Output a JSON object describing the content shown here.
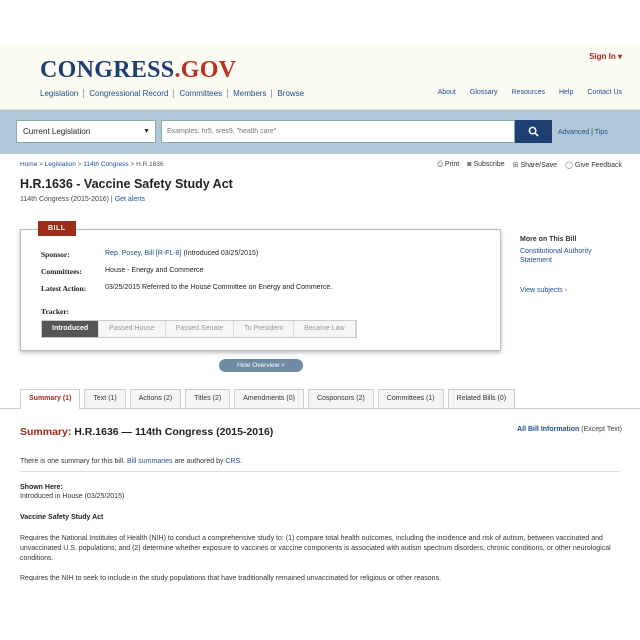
{
  "header": {
    "logo_main": "CONGRESS",
    "logo_dot": ".",
    "logo_gov": "GOV",
    "signin": "Sign In ▾",
    "nav_left": [
      "Legislation",
      "Congressional Record",
      "Committees",
      "Members",
      "Browse"
    ],
    "nav_right": [
      "About",
      "Glossary",
      "Resources",
      "Help",
      "Contact Us"
    ]
  },
  "search": {
    "collection": "Current Legislation",
    "placeholder": "Examples: hr5, sres9, \"health care\"",
    "button_icon": "search-icon",
    "advanced": "Advanced",
    "separator": " | ",
    "tips": "Tips"
  },
  "breadcrumb": {
    "home": "Home",
    "legislation": "Legislation",
    "congress": "114th Congress",
    "sep": " > ",
    "current": "H.R.1636"
  },
  "tools": {
    "print": "Print",
    "subscribe": "Subscribe",
    "share": "Share/Save",
    "feedback": "Give Feedback"
  },
  "bill": {
    "title": "H.R.1636 - Vaccine Safety Study Act",
    "congress": "114th Congress (2015-2016)",
    "divider": " | ",
    "get_alerts": "Get alerts"
  },
  "overview": {
    "tag": "BILL",
    "sponsor_label": "Sponsor:",
    "sponsor_link": "Rep. Posey, Bill [R-FL-8]",
    "sponsor_suffix": " (Introduced 03/25/2015)",
    "committees_label": "Committees:",
    "committees_value": "House - Energy and Commerce",
    "latest_label": "Latest Action:",
    "latest_value": "03/25/2015 Referred to the House Committee on Energy and Commerce.",
    "tracker_label": "Tracker:",
    "tracker_steps": [
      "Introduced",
      "Passed House",
      "Passed Senate",
      "To President",
      "Became Law"
    ],
    "tracker_current": "Introduced"
  },
  "more_on": {
    "heading": "More on This Bill",
    "link1": "Constitutional Authority",
    "link2": "Statement",
    "view_subjects": "View subjects",
    "arrow": " ›"
  },
  "hide_overview": "Hide Overview ×",
  "tabs": [
    "Summary (1)",
    "Text (1)",
    "Actions (2)",
    "Titles (2)",
    "Amendments (0)",
    "Cosponsors (2)",
    "Committees (1)",
    "Related Bills (0)"
  ],
  "summary": {
    "heading_red": "Summary:",
    "heading_rest": " H.R.1636 — 114th Congress (2015-2016)",
    "all_info_link": "All Bill Information",
    "all_info_suffix": " (Except Text)",
    "count_prefix": "There is one summary for this bill. ",
    "summaries_link": "Bill summaries",
    "authored": " are authored by ",
    "crs_link": "CRS",
    "period": ".",
    "shown_here": "Shown Here:",
    "shown_value": "Introduced in House (03/25/2015)",
    "act_name": "Vaccine Safety Study Act",
    "para1": "Requires the National Institutes of Health (NIH) to conduct a comprehensive study to: (1) compare total health outcomes, including the incidence and risk of autism, between vaccinated and unvaccinated U.S. populations; and (2) determine whether exposure to vaccines or vaccine components is associated with autism spectrum disorders, chronic conditions, or other neurological conditions.",
    "para2": "Requires the NIH to seek to include in the study populations that have traditionally remained unvaccinated for religious or other reasons."
  },
  "colors": {
    "brand_blue": "#1d3f72",
    "brand_red": "#9c2b19",
    "search_band": "#b2c8d9"
  }
}
